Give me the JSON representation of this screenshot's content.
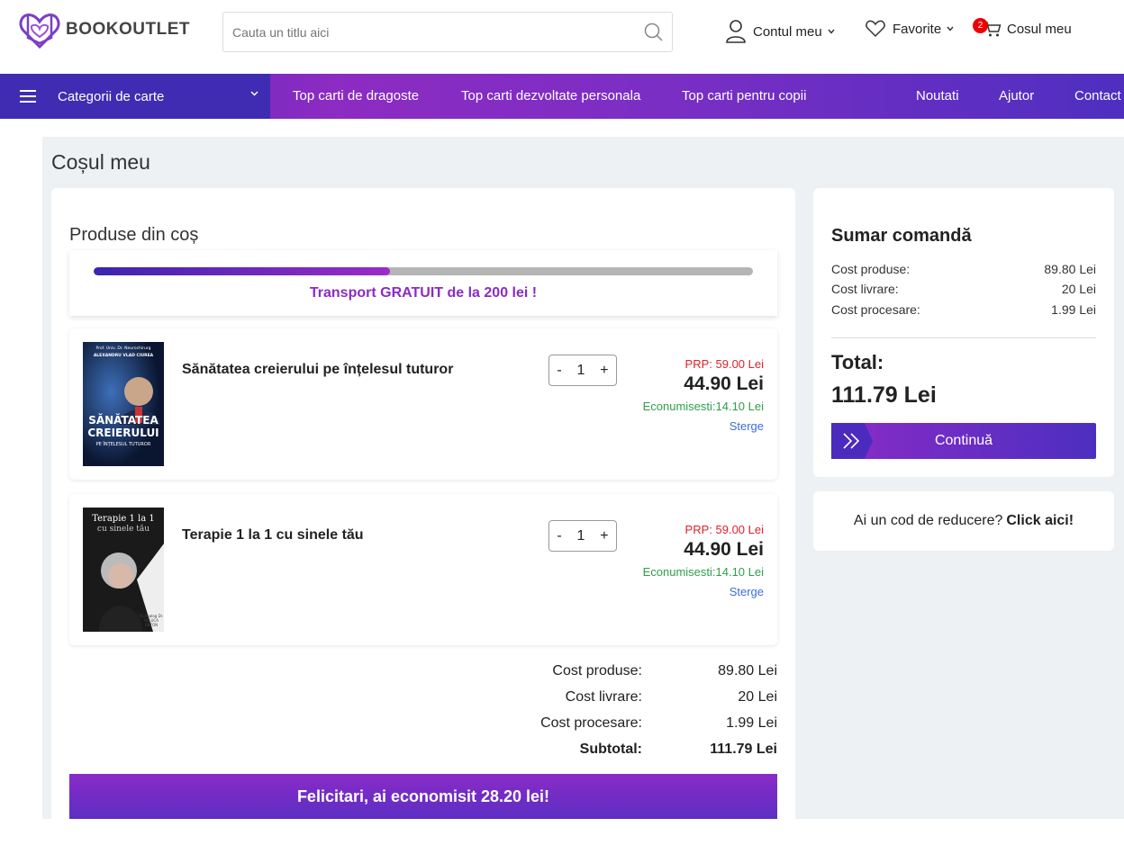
{
  "header": {
    "logo_text": "BOOKOUTLET",
    "search_placeholder": "Cauta un titlu aici",
    "account_label": "Contul meu",
    "favorites_label": "Favorite",
    "cart_label": "Cosul meu",
    "cart_count": "2"
  },
  "nav": {
    "categories_label": "Categorii de carte",
    "links": [
      "Top carti de dragoste",
      "Top carti dezvoltate personala",
      "Top carti pentru copii",
      "Noutati",
      "Ajutor",
      "Contact"
    ]
  },
  "page": {
    "title": "Coșul meu",
    "cart_heading": "Produse din coș"
  },
  "shipping": {
    "progress": 0.45,
    "text": "Transport GRATUIT de la 200 lei !"
  },
  "items": [
    {
      "title": "Sănătatea creierului pe înțelesul tuturor",
      "qty": "1",
      "prp": "PRP: 59.00 Lei",
      "price": "44.90 Lei",
      "savings": "Econumisesti:14.10 Lei",
      "delete": "Sterge",
      "cover": {
        "top": "Prof. Univ. Dr. Neurochirurg",
        "author": "ALEXANDRU VLAD CIUREA",
        "title1": "SĂNĂTATEA",
        "title2": "CREIERULUI",
        "subtitle": "PE ÎNȚELESUL TUTUROR"
      }
    },
    {
      "title": "Terapie 1 la 1 cu sinele tău",
      "qty": "1",
      "prp": "PRP: 59.00 Lei",
      "price": "44.90 Lei",
      "savings": "Econumisesti:14.10 Lei",
      "delete": "Sterge",
      "cover": {
        "title1": "Terapie 1 la 1",
        "title2": "cu sinele tău",
        "author1": "Ps.Analog Dr.",
        "author2": "RALUCA",
        "author3": "ANTON"
      }
    }
  ],
  "totals": {
    "products_label": "Cost produse:",
    "products_value": "89.80 Lei",
    "shipping_label": "Cost livrare:",
    "shipping_value": "20 Lei",
    "processing_label": "Cost procesare:",
    "processing_value": "1.99 Lei",
    "subtotal_label": "Subtotal:",
    "subtotal_value": "111.79 Lei"
  },
  "congrats": "Felicitari, ai economisit 28.20 lei!",
  "summary": {
    "title": "Sumar comandă",
    "products_label": "Cost produse:",
    "products_value": "89.80 Lei",
    "shipping_label": "Cost livrare:",
    "shipping_value": "20 Lei",
    "processing_label": "Cost procesare:",
    "processing_value": "1.99 Lei",
    "total_label": "Total:",
    "total_value": "111.79 Lei",
    "continue_label": "Continuă"
  },
  "coupon": {
    "text": "Ai un cod de reducere?",
    "link": "Click aici!"
  },
  "colors": {
    "brand_purple": "#8a2bc6",
    "brand_indigo": "#4a2bbd",
    "price_red": "#e0202a",
    "savings_green": "#2f9e4a",
    "link_blue": "#3a6fd8"
  }
}
